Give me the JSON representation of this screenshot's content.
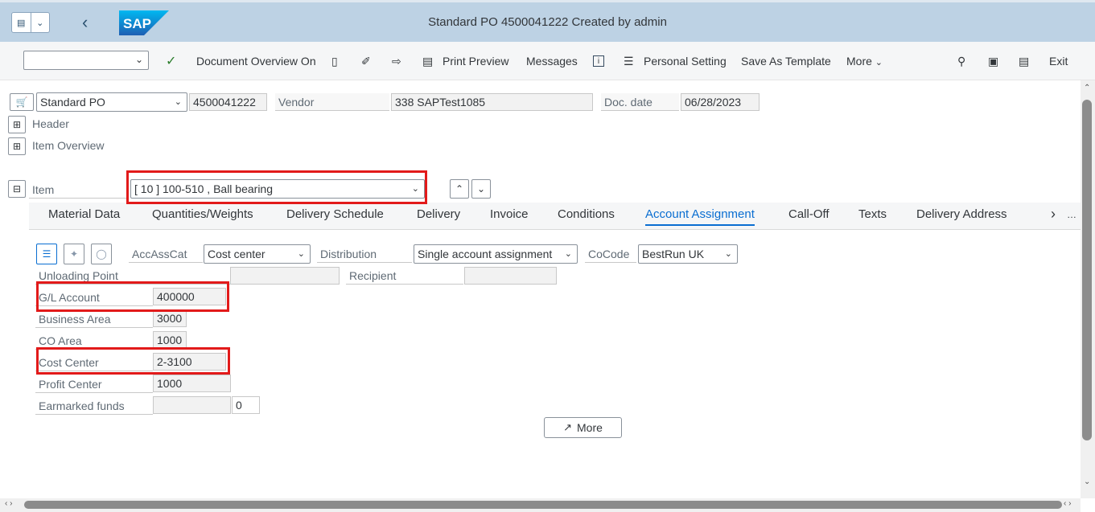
{
  "shell": {
    "title": "Standard PO 4500041222 Created by admin",
    "logo_text": "SAP",
    "menu_icon": "menu-icon",
    "back_icon": "back-arrow-icon"
  },
  "toolbar": {
    "selector_value": "",
    "doc_overview": "Document Overview On",
    "print_preview": "Print Preview",
    "messages": "Messages",
    "personal_setting": "Personal Setting",
    "save_as_template": "Save As Template",
    "more": "More",
    "exit": "Exit"
  },
  "header": {
    "po_type": "Standard PO",
    "po_number": "4500041222",
    "vendor_label": "Vendor",
    "vendor_value": "338 SAPTest1085",
    "doc_date_label": "Doc. date",
    "doc_date_value": "06/28/2023",
    "header_label": "Header",
    "item_overview_label": "Item Overview",
    "item_label": "Item",
    "item_value": "[ 10 ] 100-510 , Ball bearing"
  },
  "tabs": [
    "Material Data",
    "Quantities/Weights",
    "Delivery Schedule",
    "Delivery",
    "Invoice",
    "Conditions",
    "Account Assignment",
    "Call-Off",
    "Texts",
    "Delivery Address"
  ],
  "active_tab": "Account Assignment",
  "account": {
    "accasscat_label": "AccAssCat",
    "accasscat_value": "Cost center",
    "distribution_label": "Distribution",
    "distribution_value": "Single account assignment",
    "cocode_label": "CoCode",
    "cocode_value": "BestRun UK",
    "unloading_label": "Unloading Point",
    "unloading_value": "",
    "recipient_label": "Recipient",
    "recipient_value": "",
    "gl_label": "G/L Account",
    "gl_value": "400000",
    "business_area_label": "Business Area",
    "business_area_value": "3000",
    "co_area_label": "CO Area",
    "co_area_value": "1000",
    "cost_center_label": "Cost Center",
    "cost_center_value": "2-3100",
    "profit_center_label": "Profit Center",
    "profit_center_value": "1000",
    "earmarked_label": "Earmarked funds",
    "earmarked_value": "",
    "earmarked_count": "0",
    "more_button": "More"
  },
  "colors": {
    "shell_bg": "#bdd2e4",
    "accent": "#0a6ed1",
    "highlight": "#e21a1a"
  }
}
